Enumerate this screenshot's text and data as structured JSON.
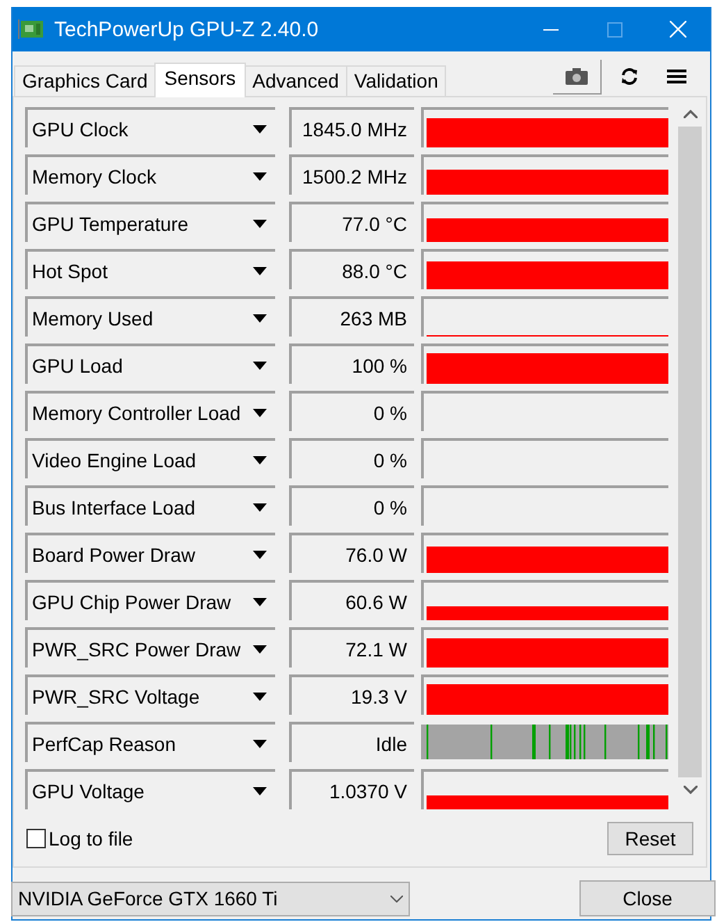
{
  "window": {
    "title": "TechPowerUp GPU-Z 2.40.0"
  },
  "tabs": [
    {
      "label": "Graphics Card",
      "selected": false
    },
    {
      "label": "Sensors",
      "selected": true
    },
    {
      "label": "Advanced",
      "selected": false
    },
    {
      "label": "Validation",
      "selected": false
    }
  ],
  "sensors": [
    {
      "name": "GPU Clock",
      "value": "1845.0 MHz",
      "kind": "graph"
    },
    {
      "name": "Memory Clock",
      "value": "1500.2 MHz",
      "kind": "graph"
    },
    {
      "name": "GPU Temperature",
      "value": "77.0 °C",
      "kind": "graph"
    },
    {
      "name": "Hot Spot",
      "value": "88.0 °C",
      "kind": "graph"
    },
    {
      "name": "Memory Used",
      "value": "263 MB",
      "kind": "graph"
    },
    {
      "name": "GPU Load",
      "value": "100 %",
      "kind": "graph"
    },
    {
      "name": "Memory Controller Load",
      "value": "0 %",
      "kind": "empty"
    },
    {
      "name": "Video Engine Load",
      "value": "0 %",
      "kind": "empty"
    },
    {
      "name": "Bus Interface Load",
      "value": "0 %",
      "kind": "empty"
    },
    {
      "name": "Board Power Draw",
      "value": "76.0 W",
      "kind": "graph"
    },
    {
      "name": "GPU Chip Power Draw",
      "value": "60.6 W",
      "kind": "graph"
    },
    {
      "name": "PWR_SRC Power Draw",
      "value": "72.1 W",
      "kind": "graph"
    },
    {
      "name": "PWR_SRC Voltage",
      "value": "19.3 V",
      "kind": "graph"
    },
    {
      "name": "PerfCap Reason",
      "value": "Idle",
      "kind": "perfcap"
    },
    {
      "name": "GPU Voltage",
      "value": "1.0370 V",
      "kind": "graph"
    }
  ],
  "log_to_file": {
    "label": "Log to file",
    "checked": false
  },
  "reset_button": "Reset",
  "gpu_select": {
    "value": "NVIDIA GeForce GTX 1660 Ti"
  },
  "close_button": "Close"
}
